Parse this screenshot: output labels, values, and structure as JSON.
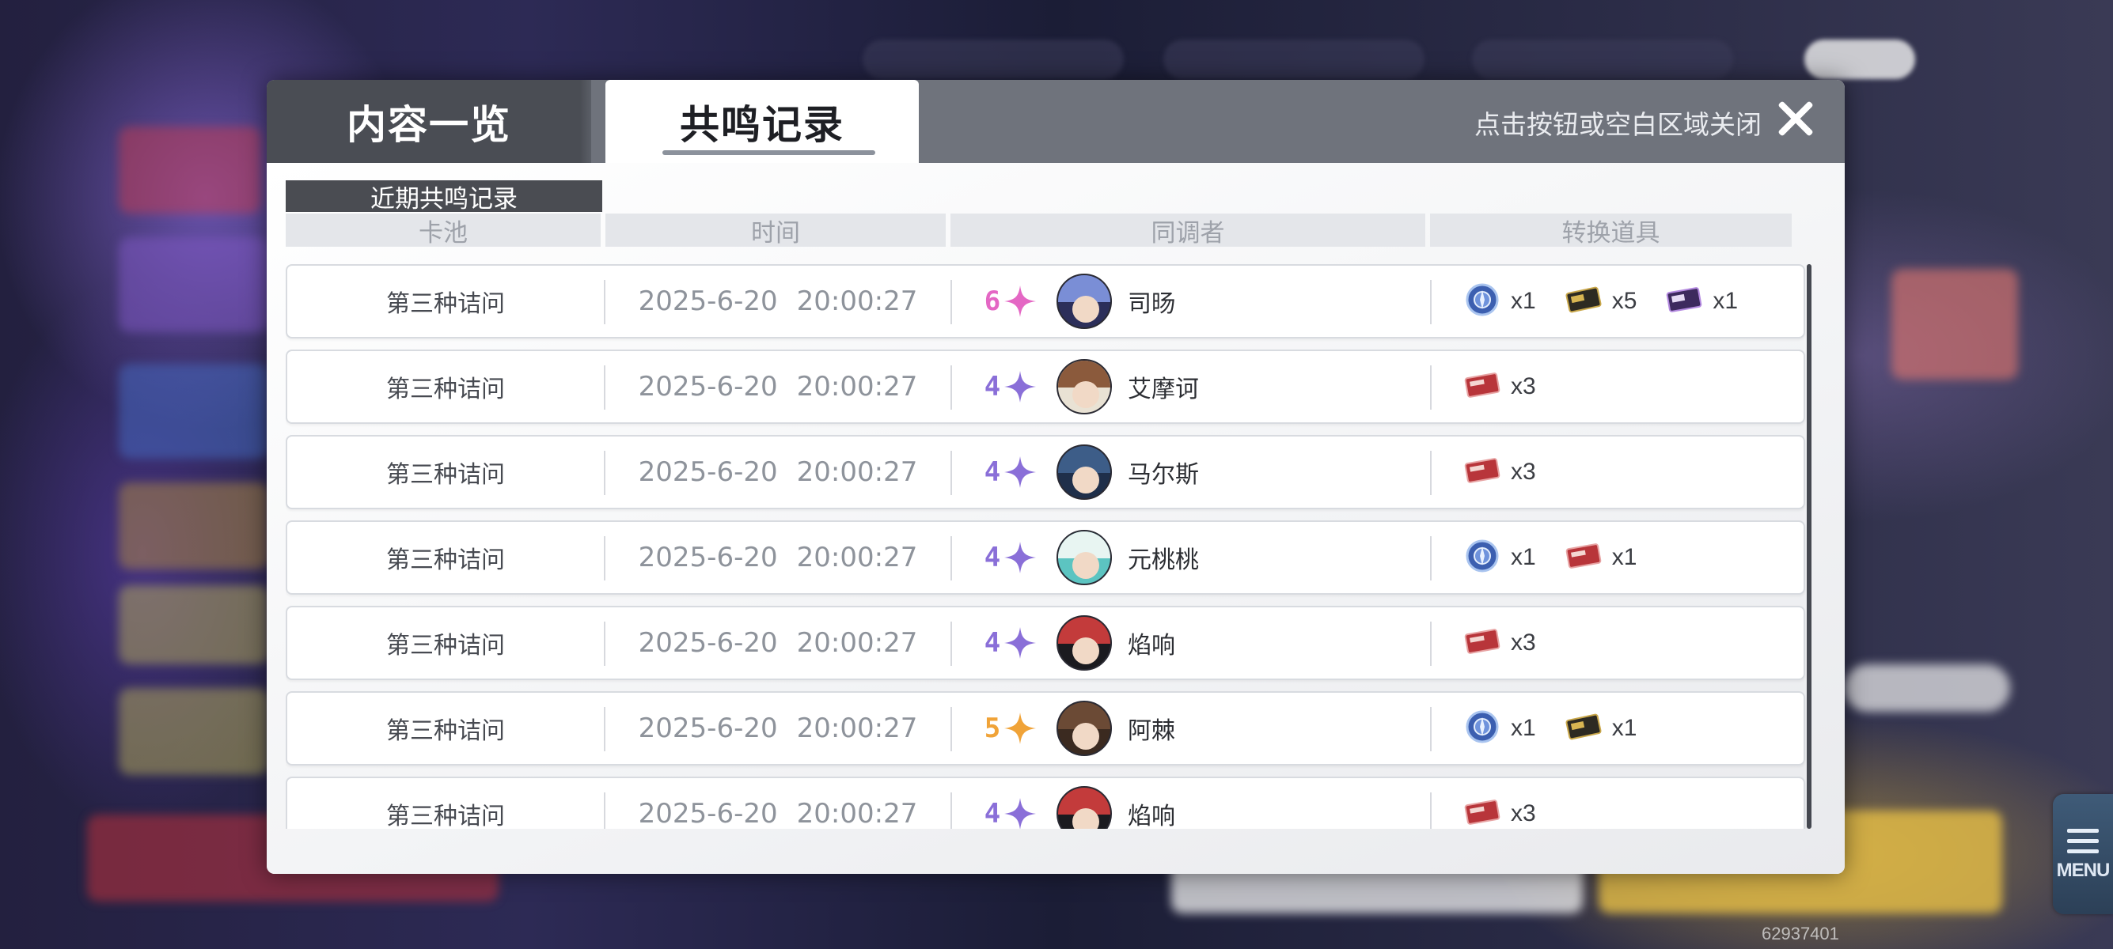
{
  "header": {
    "close_hint": "点击按钮或空白区域关闭"
  },
  "tabs": [
    {
      "label": "内容一览",
      "active": false
    },
    {
      "label": "共鸣记录",
      "active": true
    }
  ],
  "section_title": "近期共鸣记录",
  "columns": [
    "卡池",
    "时间",
    "同调者",
    "转换道具"
  ],
  "records": [
    {
      "pool": "第三种诘问",
      "date": "2025-6-20",
      "time": "20:00:27",
      "rarity": "6",
      "rarity_color": "#e467c4",
      "name": "司旸",
      "avatar": "dark-hair-avatar",
      "items": [
        {
          "icon": "blue-orb-token-icon",
          "qty": "x1"
        },
        {
          "icon": "gold-ticket-icon",
          "qty": "x5"
        },
        {
          "icon": "purple-ticket-icon",
          "qty": "x1"
        }
      ]
    },
    {
      "pool": "第三种诘问",
      "date": "2025-6-20",
      "time": "20:00:27",
      "rarity": "4",
      "rarity_color": "#8a6fd8",
      "name": "艾摩诃",
      "avatar": "tan-skin-avatar",
      "items": [
        {
          "icon": "red-ticket-icon",
          "qty": "x3"
        }
      ]
    },
    {
      "pool": "第三种诘问",
      "date": "2025-6-20",
      "time": "20:00:27",
      "rarity": "4",
      "rarity_color": "#8a6fd8",
      "name": "马尔斯",
      "avatar": "navy-hair-avatar",
      "items": [
        {
          "icon": "red-ticket-icon",
          "qty": "x3"
        }
      ]
    },
    {
      "pool": "第三种诘问",
      "date": "2025-6-20",
      "time": "20:00:27",
      "rarity": "4",
      "rarity_color": "#8a6fd8",
      "name": "元桃桃",
      "avatar": "teal-hair-avatar",
      "items": [
        {
          "icon": "blue-orb-token-icon",
          "qty": "x1"
        },
        {
          "icon": "red-ticket-icon",
          "qty": "x1"
        }
      ]
    },
    {
      "pool": "第三种诘问",
      "date": "2025-6-20",
      "time": "20:00:27",
      "rarity": "4",
      "rarity_color": "#8a6fd8",
      "name": "焰响",
      "avatar": "black-hat-avatar",
      "items": [
        {
          "icon": "red-ticket-icon",
          "qty": "x3"
        }
      ]
    },
    {
      "pool": "第三种诘问",
      "date": "2025-6-20",
      "time": "20:00:27",
      "rarity": "5",
      "rarity_color": "#f0a338",
      "name": "阿棘",
      "avatar": "brown-hair-avatar",
      "items": [
        {
          "icon": "blue-orb-token-icon",
          "qty": "x1"
        },
        {
          "icon": "gold-ticket-icon",
          "qty": "x1"
        }
      ]
    },
    {
      "pool": "第三种诘问",
      "date": "2025-6-20",
      "time": "20:00:27",
      "rarity": "4",
      "rarity_color": "#8a6fd8",
      "name": "焰响",
      "avatar": "black-hat-avatar",
      "items": [
        {
          "icon": "red-ticket-icon",
          "qty": "x3"
        }
      ]
    }
  ],
  "side_menu": {
    "label": "MENU"
  },
  "uid": "62937401"
}
